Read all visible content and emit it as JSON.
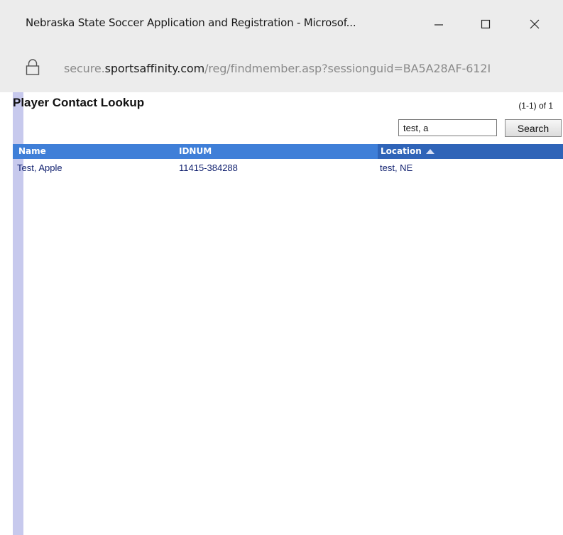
{
  "window": {
    "title": "Nebraska State Soccer Application and Registration - Microsof...",
    "minimize_icon": "minimize-icon",
    "maximize_icon": "maximize-icon",
    "close_icon": "close-icon"
  },
  "address_bar": {
    "lock_icon": "lock-icon",
    "url_prefix": "secure.",
    "url_domain": "sportsaffinity.com",
    "url_path": "/reg/findmember.asp?sessionguid=BA5A28AF-612I"
  },
  "page": {
    "title": "Player Contact Lookup",
    "count": "(1-1) of 1",
    "search": {
      "value": "test, a",
      "button_label": "Search"
    }
  },
  "table": {
    "columns": [
      {
        "label": "Name"
      },
      {
        "label": "IDNUM"
      },
      {
        "label": "Location",
        "sort_icon": "sort-up-icon"
      }
    ],
    "rows": [
      {
        "name": "Test, Apple",
        "idnum": "11415-384288",
        "location": "test, NE"
      }
    ]
  },
  "colors": {
    "header_bg": "#3f7fd8",
    "sorted_header_bg": "#2f64b8",
    "row_text": "#0f1f6e",
    "left_strip": "#c7c9ed",
    "chrome_bg": "#ececec"
  }
}
